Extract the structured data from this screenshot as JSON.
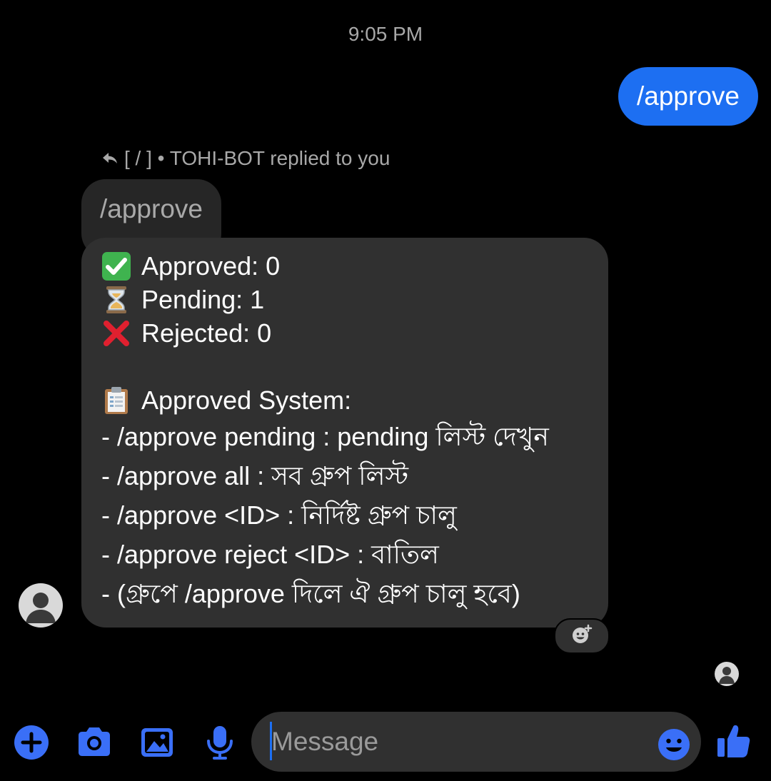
{
  "conversation": {
    "timestamp": "9:05 PM",
    "sent_message": "/approve",
    "reply_meta": {
      "icon": "reply-arrow-icon",
      "text": "[ / ] • TOHI-BOT replied to you"
    },
    "quoted_message": "/approve",
    "bot_message": {
      "status_lines": [
        {
          "icon": "check-mark-button-icon",
          "text": "Approved: 0"
        },
        {
          "icon": "hourglass-icon",
          "text": "Pending: 1"
        },
        {
          "icon": "cross-mark-icon",
          "text": "Rejected: 0"
        }
      ],
      "system_header": {
        "icon": "clipboard-icon",
        "text": "Approved System:"
      },
      "commands": [
        "- /approve pending : pending লিস্ট দেখুন",
        "- /approve all : সব গ্রুপ লিস্ট",
        "- /approve <ID> : নির্দিষ্ট গ্রুপ চালু",
        "- /approve reject <ID> : বাতিল",
        "- (গ্রুপে /approve দিলে ঐ গ্রুপ চালু হবে)"
      ]
    }
  },
  "composer": {
    "placeholder": "Message",
    "value": ""
  },
  "toolbar": {
    "icons": [
      "plus-icon",
      "camera-icon",
      "gallery-icon",
      "microphone-icon",
      "emoji-icon",
      "thumbs-up-icon"
    ]
  },
  "colors": {
    "background": "#000000",
    "accent": "#1d6ff2",
    "incoming_bubble": "#303030",
    "quoted_bubble": "#262626",
    "muted_text": "#a8a8a8"
  }
}
